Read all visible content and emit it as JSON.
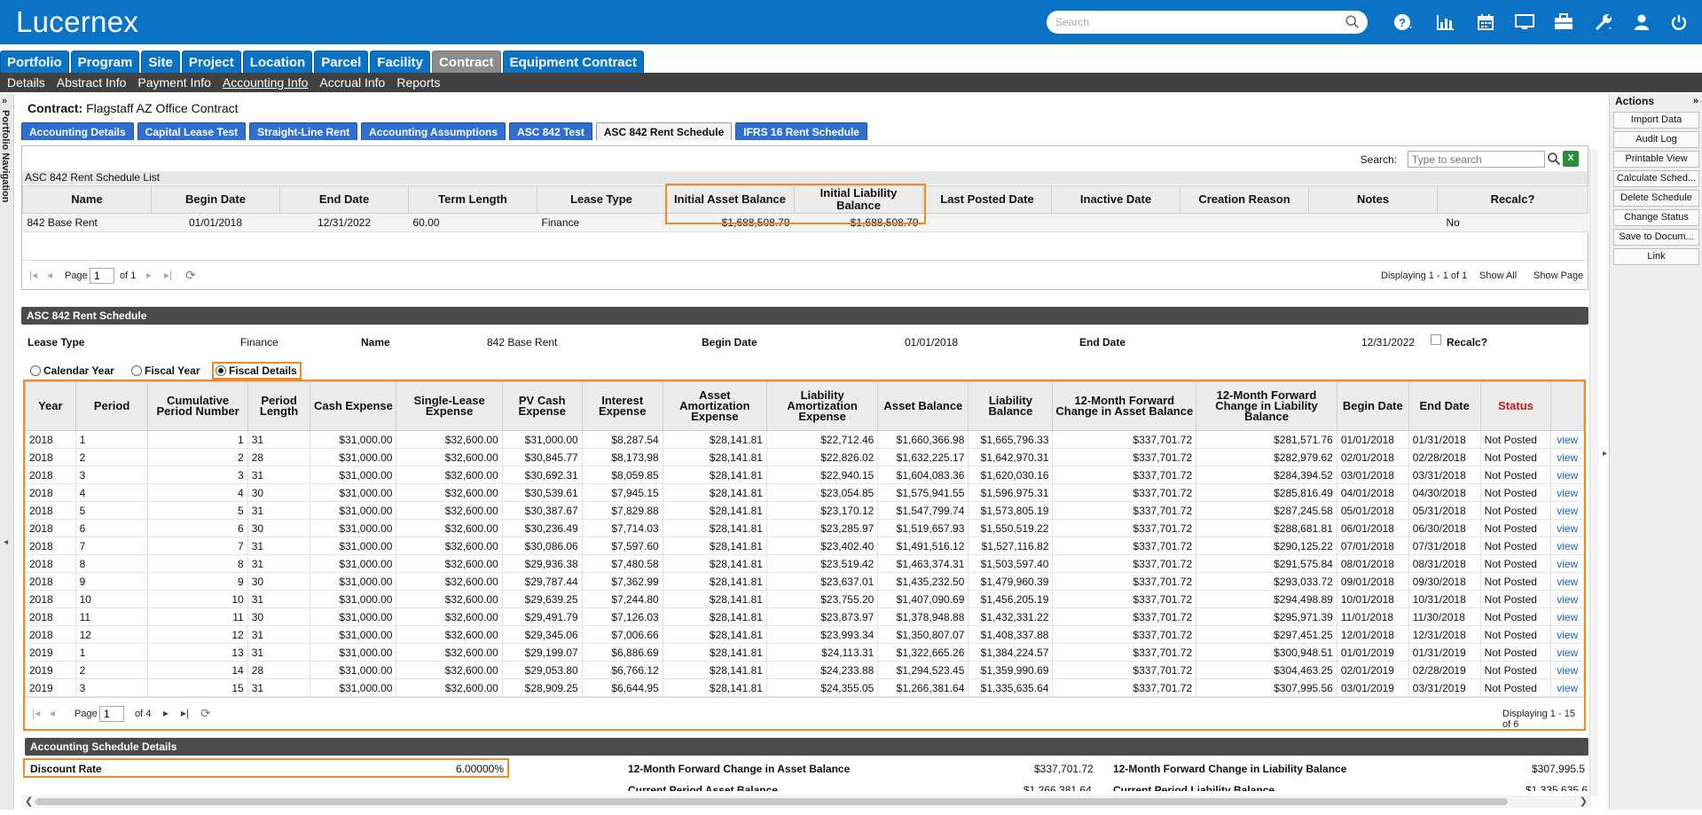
{
  "app": {
    "brand": "Lucernex",
    "search_placeholder": "Search"
  },
  "module_tabs": [
    {
      "label": "Portfolio"
    },
    {
      "label": "Program"
    },
    {
      "label": "Site"
    },
    {
      "label": "Project"
    },
    {
      "label": "Location"
    },
    {
      "label": "Parcel"
    },
    {
      "label": "Facility"
    },
    {
      "label": "Contract"
    },
    {
      "label": "Equipment Contract"
    }
  ],
  "active_module": "Contract",
  "subnav": [
    {
      "label": "Details"
    },
    {
      "label": "Abstract Info"
    },
    {
      "label": "Payment Info"
    },
    {
      "label": "Accounting Info"
    },
    {
      "label": "Accrual Info"
    },
    {
      "label": "Reports"
    }
  ],
  "active_subnav": "Accounting Info",
  "left_nav_label": "Portfolio Navigation",
  "contract": {
    "label": "Contract:",
    "name": "Flagstaff AZ Office Contract"
  },
  "accounting_tabs": [
    {
      "label": "Accounting Details"
    },
    {
      "label": "Capital Lease Test"
    },
    {
      "label": "Straight-Line Rent"
    },
    {
      "label": "Accounting Assumptions"
    },
    {
      "label": "ASC 842 Test"
    },
    {
      "label": "ASC 842 Rent Schedule"
    },
    {
      "label": "IFRS 16 Rent Schedule"
    }
  ],
  "active_accounting_tab": "ASC 842 Rent Schedule",
  "list": {
    "search_label": "Search:",
    "search_placeholder": "Type to search",
    "title": "ASC 842 Rent Schedule List",
    "columns": [
      "Name",
      "Begin Date",
      "End Date",
      "Term Length",
      "Lease Type",
      "Initial Asset Balance",
      "Initial Liability Balance",
      "Last Posted Date",
      "Inactive Date",
      "Creation Reason",
      "Notes",
      "Recalc?"
    ],
    "row": {
      "name": "842 Base Rent",
      "begin": "01/01/2018",
      "end": "12/31/2022",
      "term": "60.00",
      "lease_type": "Finance",
      "initial_asset": "$1,688,508.79",
      "initial_liability": "$1,688,508.79",
      "last_posted": "",
      "inactive": "",
      "reason": "",
      "notes": "",
      "recalc": "No"
    },
    "pager": {
      "page_label": "Page",
      "page": "1",
      "of": "of 1",
      "displaying": "Displaying 1 - 1 of 1",
      "show_all": "Show All",
      "show_page": "Show Page"
    }
  },
  "schedule": {
    "title": "ASC 842 Rent Schedule",
    "lease_type_label": "Lease Type",
    "lease_type": "Finance",
    "name_label": "Name",
    "name": "842 Base Rent",
    "begin_label": "Begin Date",
    "begin": "01/01/2018",
    "end_label": "End Date",
    "end": "12/31/2022",
    "recalc_label": "Recalc?",
    "views": {
      "calendar": "Calendar Year",
      "fiscal_year": "Fiscal Year",
      "fiscal_details": "Fiscal Details",
      "selected": "Fiscal Details"
    },
    "columns": [
      "Year",
      "Period",
      "Cumulative Period Number",
      "Period Length",
      "Cash Expense",
      "Single-Lease Expense",
      "PV Cash Expense",
      "Interest Expense",
      "Asset Amortization Expense",
      "Liability Amortization Expense",
      "Asset Balance",
      "Liability Balance",
      "12-Month Forward Change in Asset Balance",
      "12-Month Forward Change in Liability Balance",
      "Begin Date",
      "End Date",
      "Status",
      ""
    ],
    "rows": [
      [
        "2018",
        "1",
        "1",
        "31",
        "$31,000.00",
        "$32,600.00",
        "$31,000.00",
        "$8,287.54",
        "$28,141.81",
        "$22,712.46",
        "$1,660,366.98",
        "$1,665,796.33",
        "$337,701.72",
        "$281,571.76",
        "01/01/2018",
        "01/31/2018",
        "Not Posted",
        "view"
      ],
      [
        "2018",
        "2",
        "2",
        "28",
        "$31,000.00",
        "$32,600.00",
        "$30,845.77",
        "$8,173.98",
        "$28,141.81",
        "$22,826.02",
        "$1,632,225.17",
        "$1,642,970.31",
        "$337,701.72",
        "$282,979.62",
        "02/01/2018",
        "02/28/2018",
        "Not Posted",
        "view"
      ],
      [
        "2018",
        "3",
        "3",
        "31",
        "$31,000.00",
        "$32,600.00",
        "$30,692.31",
        "$8,059.85",
        "$28,141.81",
        "$22,940.15",
        "$1,604,083.36",
        "$1,620,030.16",
        "$337,701.72",
        "$284,394.52",
        "03/01/2018",
        "03/31/2018",
        "Not Posted",
        "view"
      ],
      [
        "2018",
        "4",
        "4",
        "30",
        "$31,000.00",
        "$32,600.00",
        "$30,539.61",
        "$7,945.15",
        "$28,141.81",
        "$23,054.85",
        "$1,575,941.55",
        "$1,596,975.31",
        "$337,701.72",
        "$285,816.49",
        "04/01/2018",
        "04/30/2018",
        "Not Posted",
        "view"
      ],
      [
        "2018",
        "5",
        "5",
        "31",
        "$31,000.00",
        "$32,600.00",
        "$30,387.67",
        "$7,829.88",
        "$28,141.81",
        "$23,170.12",
        "$1,547,799.74",
        "$1,573,805.19",
        "$337,701.72",
        "$287,245.58",
        "05/01/2018",
        "05/31/2018",
        "Not Posted",
        "view"
      ],
      [
        "2018",
        "6",
        "6",
        "30",
        "$31,000.00",
        "$32,600.00",
        "$30,236.49",
        "$7,714.03",
        "$28,141.81",
        "$23,285.97",
        "$1,519,657.93",
        "$1,550,519.22",
        "$337,701.72",
        "$288,681.81",
        "06/01/2018",
        "06/30/2018",
        "Not Posted",
        "view"
      ],
      [
        "2018",
        "7",
        "7",
        "31",
        "$31,000.00",
        "$32,600.00",
        "$30,086.06",
        "$7,597.60",
        "$28,141.81",
        "$23,402.40",
        "$1,491,516.12",
        "$1,527,116.82",
        "$337,701.72",
        "$290,125.22",
        "07/01/2018",
        "07/31/2018",
        "Not Posted",
        "view"
      ],
      [
        "2018",
        "8",
        "8",
        "31",
        "$31,000.00",
        "$32,600.00",
        "$29,936.38",
        "$7,480.58",
        "$28,141.81",
        "$23,519.42",
        "$1,463,374.31",
        "$1,503,597.40",
        "$337,701.72",
        "$291,575.84",
        "08/01/2018",
        "08/31/2018",
        "Not Posted",
        "view"
      ],
      [
        "2018",
        "9",
        "9",
        "30",
        "$31,000.00",
        "$32,600.00",
        "$29,787.44",
        "$7,362.99",
        "$28,141.81",
        "$23,637.01",
        "$1,435,232.50",
        "$1,479,960.39",
        "$337,701.72",
        "$293,033.72",
        "09/01/2018",
        "09/30/2018",
        "Not Posted",
        "view"
      ],
      [
        "2018",
        "10",
        "10",
        "31",
        "$31,000.00",
        "$32,600.00",
        "$29,639.25",
        "$7,244.80",
        "$28,141.81",
        "$23,755.20",
        "$1,407,090.69",
        "$1,456,205.19",
        "$337,701.72",
        "$294,498.89",
        "10/01/2018",
        "10/31/2018",
        "Not Posted",
        "view"
      ],
      [
        "2018",
        "11",
        "11",
        "30",
        "$31,000.00",
        "$32,600.00",
        "$29,491.79",
        "$7,126.03",
        "$28,141.81",
        "$23,873.97",
        "$1,378,948.88",
        "$1,432,331.22",
        "$337,701.72",
        "$295,971.39",
        "11/01/2018",
        "11/30/2018",
        "Not Posted",
        "view"
      ],
      [
        "2018",
        "12",
        "12",
        "31",
        "$31,000.00",
        "$32,600.00",
        "$29,345.06",
        "$7,006.66",
        "$28,141.81",
        "$23,993.34",
        "$1,350,807.07",
        "$1,408,337.88",
        "$337,701.72",
        "$297,451.25",
        "12/01/2018",
        "12/31/2018",
        "Not Posted",
        "view"
      ],
      [
        "2019",
        "1",
        "13",
        "31",
        "$31,000.00",
        "$32,600.00",
        "$29,199.07",
        "$6,886.69",
        "$28,141.81",
        "$24,113.31",
        "$1,322,665.26",
        "$1,384,224.57",
        "$337,701.72",
        "$300,948.51",
        "01/01/2019",
        "01/31/2019",
        "Not Posted",
        "view"
      ],
      [
        "2019",
        "2",
        "14",
        "28",
        "$31,000.00",
        "$32,600.00",
        "$29,053.80",
        "$6,766.12",
        "$28,141.81",
        "$24,233.88",
        "$1,294,523.45",
        "$1,359,990.69",
        "$337,701.72",
        "$304,463.25",
        "02/01/2019",
        "02/28/2019",
        "Not Posted",
        "view"
      ],
      [
        "2019",
        "3",
        "15",
        "31",
        "$31,000.00",
        "$32,600.00",
        "$28,909.25",
        "$6,644.95",
        "$28,141.81",
        "$24,355.05",
        "$1,266,381.64",
        "$1,335,635.64",
        "$337,701.72",
        "$307,995.56",
        "03/01/2019",
        "03/31/2019",
        "Not Posted",
        "view"
      ]
    ],
    "pager": {
      "page_label": "Page",
      "page": "1",
      "of": "of 4",
      "displaying": "Displaying 1 - 15 of 6"
    }
  },
  "accounting_details": {
    "title": "Accounting Schedule Details",
    "discount_label": "Discount Rate",
    "discount": "6.00000%",
    "fwd_asset_label": "12-Month Forward Change in Asset Balance",
    "fwd_asset": "$337,701.72",
    "fwd_liab_label": "12-Month Forward Change in Liability Balance",
    "fwd_liab": "$307,995.5",
    "cur_asset_label": "Current Period Asset Balance",
    "cur_asset": "$1,266,381.64",
    "cur_liab_label": "Current Period Liability Balance",
    "cur_liab": "$1,335,635.6"
  },
  "actions": {
    "title": "Actions",
    "buttons": [
      "Import Data",
      "Audit Log",
      "Printable View",
      "Calculate Sched...",
      "Delete Schedule",
      "Change Status",
      "Save to Docum...",
      "Link"
    ]
  }
}
